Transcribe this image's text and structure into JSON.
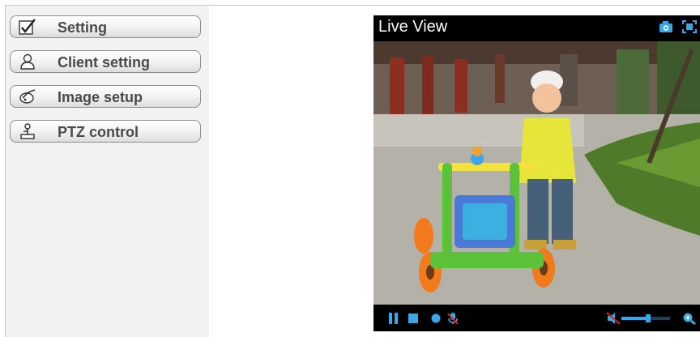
{
  "menu": {
    "items": [
      {
        "label": "Setting",
        "icon": "checkmark-icon"
      },
      {
        "label": "Client setting",
        "icon": "user-icon"
      },
      {
        "label": "Image setup",
        "icon": "image-adjust-icon"
      },
      {
        "label": "PTZ control",
        "icon": "joystick-icon"
      }
    ]
  },
  "live_view": {
    "title": "Live View",
    "top_icons": [
      "camera-snapshot-icon",
      "fullscreen-icon"
    ],
    "controls": [
      "pause-icon",
      "stop-icon",
      "record-icon",
      "microphone-off-icon",
      "speaker-mute-icon",
      "volume-slider",
      "zoom-icon"
    ],
    "volume_level": 0.55
  },
  "colors": {
    "accent_blue": "#3aa7e6",
    "sidebar_bg": "#f2f2f2",
    "button_text": "#4a4a4a"
  }
}
